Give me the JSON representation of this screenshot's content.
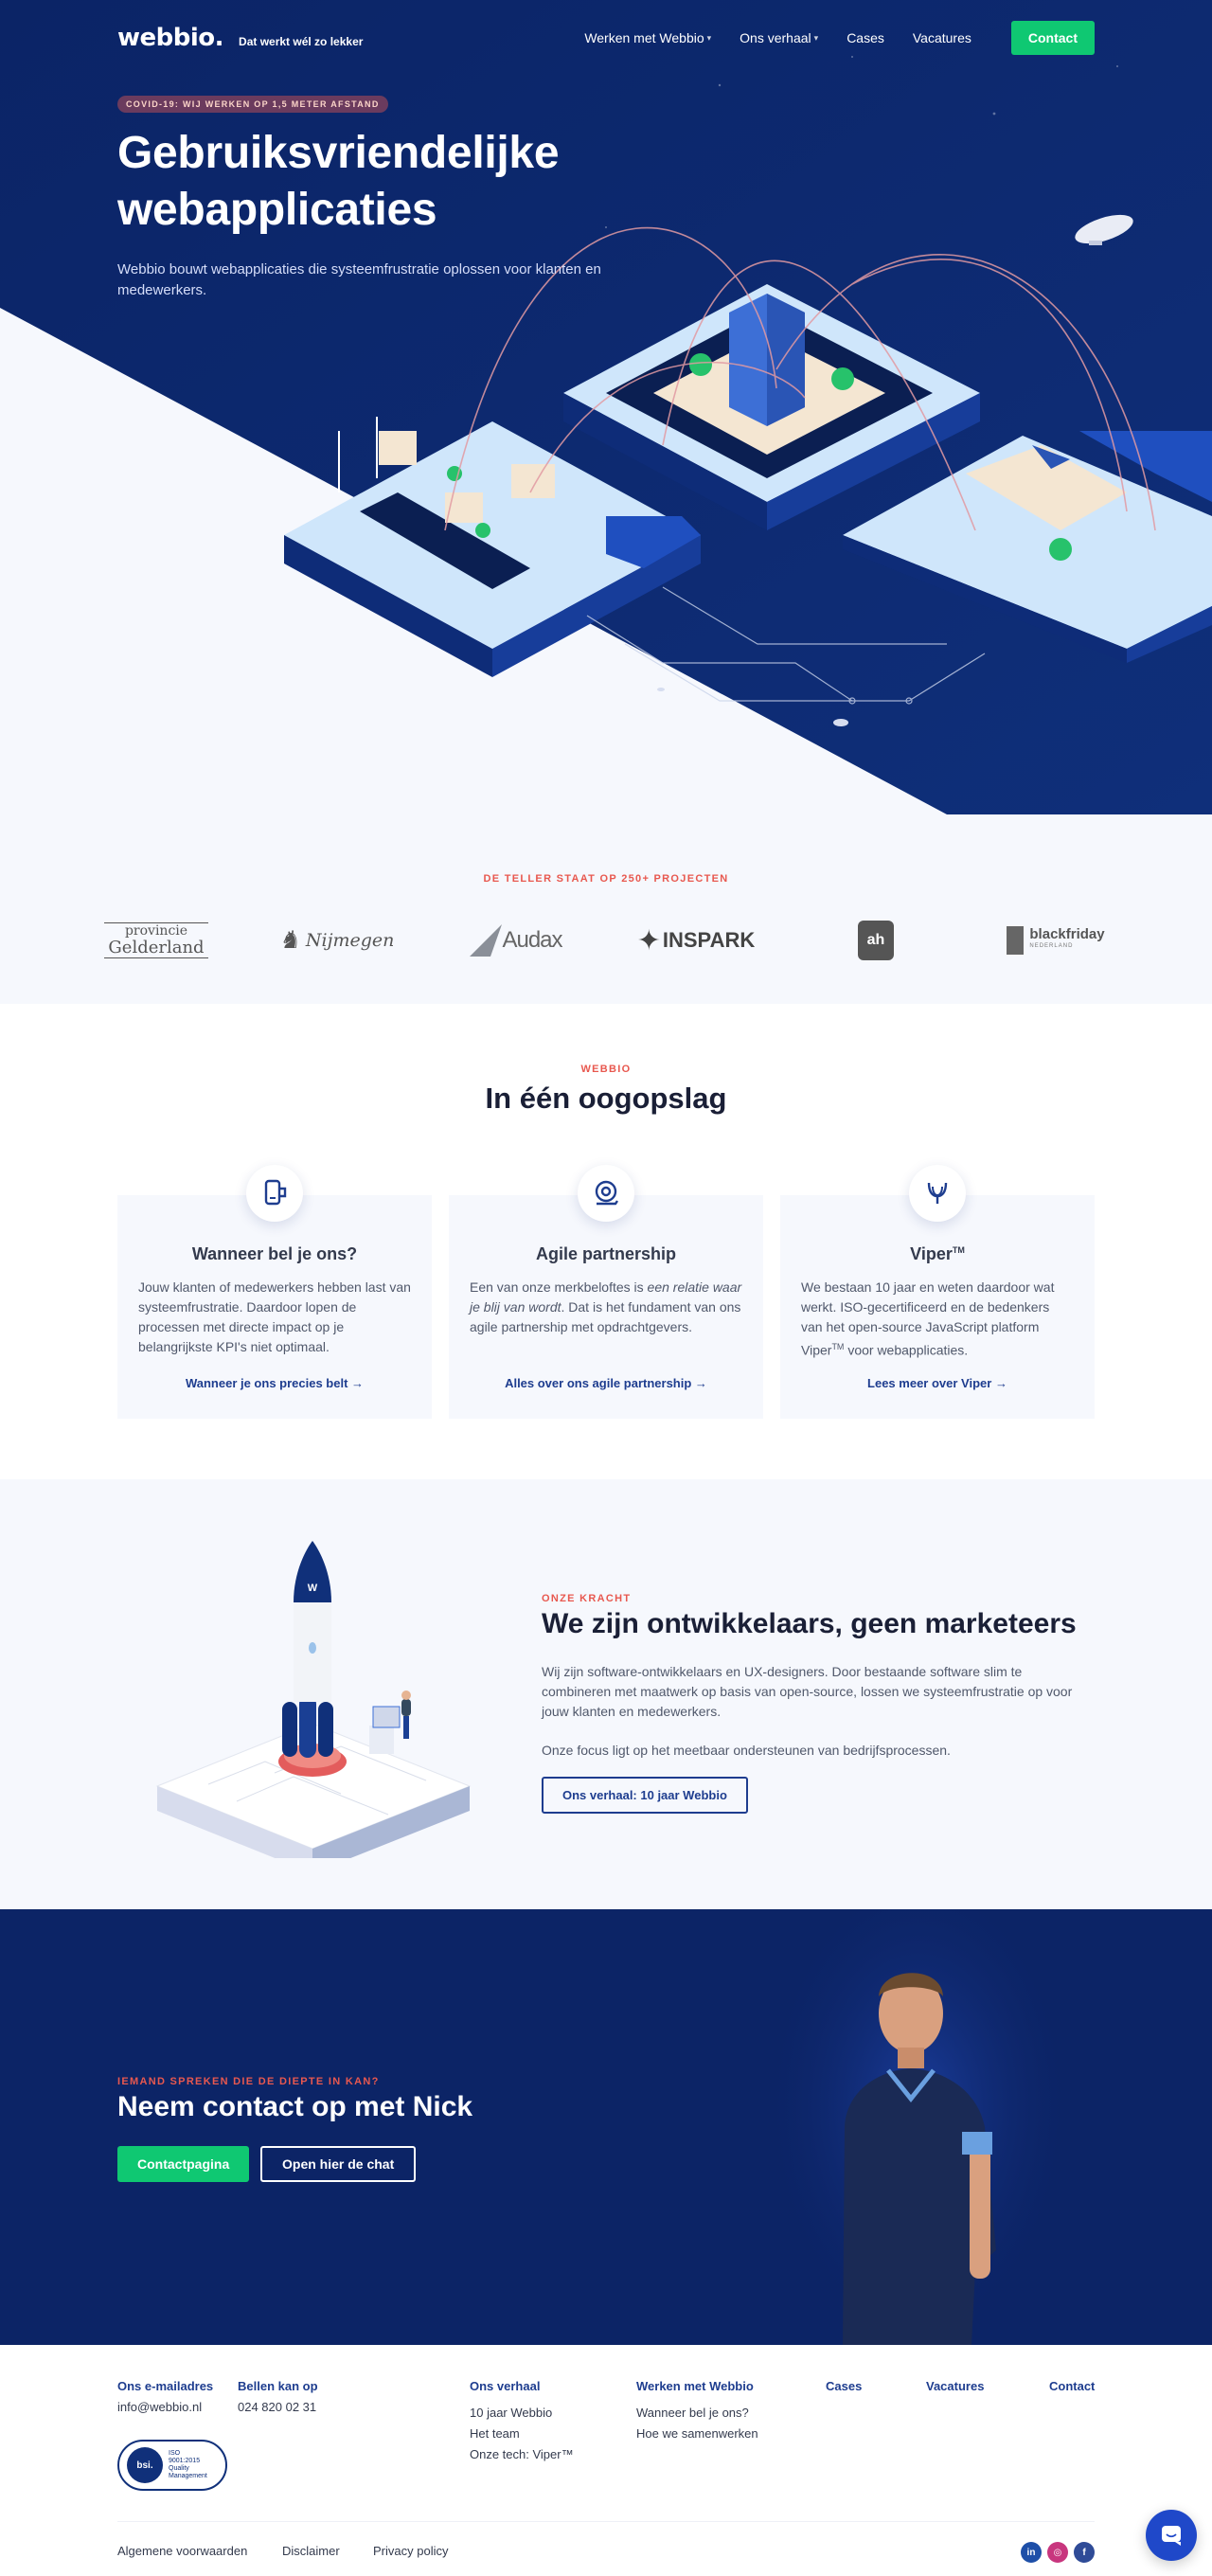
{
  "header": {
    "logo": "webbio.",
    "tagline": "Dat werkt wél zo lekker",
    "menu": [
      {
        "label": "Werken met Webbio"
      },
      {
        "label": "Ons verhaal"
      },
      {
        "label": "Cases"
      },
      {
        "label": "Vacatures"
      }
    ],
    "contact_button": "Contact"
  },
  "hero": {
    "badge": "COVID-19: WIJ WERKEN OP 1,5 METER AFSTAND",
    "title": "Gebruiksvriendelijke webapplicaties",
    "subtitle": "Webbio bouwt webapplicaties die systeemfrustratie oplossen voor klanten en medewerkers."
  },
  "clients": {
    "eyebrow": "DE TELLER STAAT OP 250+ PROJECTEN",
    "logos": [
      {
        "line1": "provincie",
        "line2": "Gelderland"
      },
      {
        "name": "Nijmegen"
      },
      {
        "name": "Audax"
      },
      {
        "name": "INSPARK"
      },
      {
        "name": "ah"
      },
      {
        "name": "blackfriday",
        "sub": "NEDERLAND"
      }
    ]
  },
  "glance": {
    "eyebrow": "WEBBIO",
    "title": "In één oogopslag",
    "cards": [
      {
        "icon": "phone-icon",
        "title": "Wanneer bel je ons?",
        "text": "Jouw klanten of medewerkers hebben last van systeemfrustratie. Daardoor lopen de processen met directe impact op je belangrijkste KPI's niet optimaal.",
        "link": "Wanneer je ons precies belt"
      },
      {
        "icon": "partnership-icon",
        "title": "Agile partnership",
        "text_before": "Een van onze merkbeloftes is ",
        "text_em": "een relatie waar je blij van wordt",
        "text_after": ". Dat is het fundament van ons agile partnership met opdrachtgevers.",
        "link": "Alles over ons agile partnership"
      },
      {
        "icon": "viper-icon",
        "title": "Viper",
        "title_sup": "TM",
        "text_before": "We bestaan 10 jaar en weten daardoor wat werkt. ISO-gecertificeerd en de bedenkers van het open-source JavaScript platform Viper",
        "text_sup": "TM",
        "text_after": " voor webapplicaties.",
        "link": "Lees meer over Viper"
      }
    ]
  },
  "strength": {
    "eyebrow": "ONZE KRACHT",
    "title": "We zijn ontwikkelaars, geen marketeers",
    "p1": "Wij zijn software-ontwikkelaars en UX-designers. Door bestaande software slim te combineren met maatwerk op basis van open-source, lossen we systeemfrustratie op voor jouw klanten en medewerkers.",
    "p2": "Onze focus ligt op het meetbaar ondersteunen van bedrijfsprocessen.",
    "button": "Ons verhaal: 10 jaar Webbio"
  },
  "contact": {
    "eyebrow": "IEMAND SPREKEN DIE DE DIEPTE IN KAN?",
    "title": "Neem contact op met Nick",
    "primary": "Contactpagina",
    "secondary": "Open hier de chat"
  },
  "footer": {
    "email_head": "Ons e-mailadres",
    "email": "info@webbio.nl",
    "phone_head": "Bellen kan op",
    "phone": "024 820 02 31",
    "iso": {
      "bsi": "bsi.",
      "line1": "ISO",
      "line2": "9001:2015",
      "line3": "Quality",
      "line4": "Management"
    },
    "cols": [
      {
        "head": "Ons verhaal",
        "items": [
          "10 jaar Webbio",
          "Het team",
          "Onze tech: Viper™"
        ]
      },
      {
        "head": "Werken met Webbio",
        "items": [
          "Wanneer bel je ons?",
          "Hoe we samenwerken"
        ]
      },
      {
        "head": "Cases",
        "items": []
      },
      {
        "head": "Vacatures",
        "items": []
      },
      {
        "head": "Contact",
        "items": []
      }
    ],
    "legal": [
      "Algemene voorwaarden",
      "Disclaimer",
      "Privacy policy"
    ],
    "social": [
      {
        "icon": "linkedin-icon",
        "glyph": "in",
        "color": "#1e4fa8"
      },
      {
        "icon": "instagram-icon",
        "glyph": "◎",
        "color": "#c8367e"
      },
      {
        "icon": "facebook-icon",
        "glyph": "f",
        "color": "#2f4b97"
      }
    ]
  },
  "colors": {
    "navy": "#0c2466",
    "green": "#0fc872",
    "accent": "#e8584f",
    "link": "#1e3d8f"
  }
}
